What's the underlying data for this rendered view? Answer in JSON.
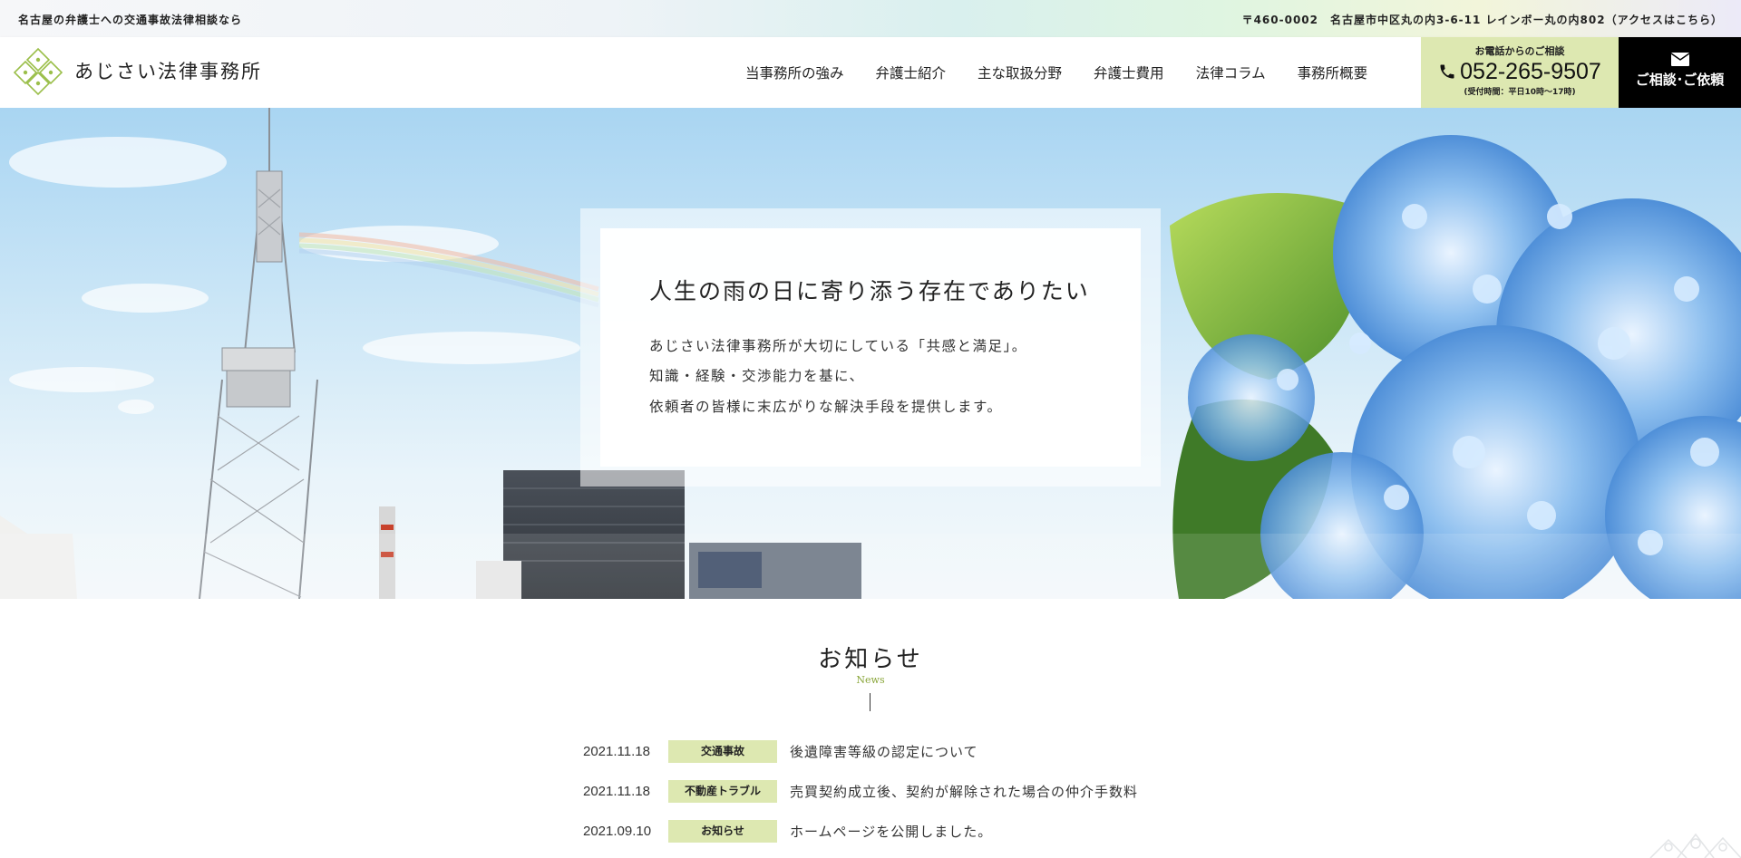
{
  "topbar": {
    "tagline": "名古屋の弁護士への交通事故法律相談なら",
    "address": "〒460-0002　名古屋市中区丸の内3-6-11 レインボー丸の内802（アクセスはこちら）"
  },
  "header": {
    "logo_text": "あじさい法律事務所",
    "nav": [
      "当事務所の強み",
      "弁護士紹介",
      "主な取扱分野",
      "弁護士費用",
      "法律コラム",
      "事務所概要"
    ],
    "tel_label": "お電話からのご相談",
    "tel_number": "052-265-9507",
    "tel_hours": "(受付時間：平日10時〜17時)",
    "consult_label": "ご相談･ご依頼"
  },
  "hero": {
    "title": "人生の雨の日に寄り添う存在でありたい",
    "lines": [
      "あじさい法律事務所が大切にしている「共感と満足」。",
      "知識・経験・交渉能力を基に、",
      "依頼者の皆様に末広がりな解決手段を提供します。"
    ]
  },
  "news": {
    "heading": "お知らせ",
    "subheading": "News",
    "items": [
      {
        "date": "2021.11.18",
        "category": "交通事故",
        "title": "後遺障害等級の認定について"
      },
      {
        "date": "2021.11.18",
        "category": "不動産トラブル",
        "title": "売買契約成立後、契約が解除された場合の仲介手数料"
      },
      {
        "date": "2021.09.10",
        "category": "お知らせ",
        "title": "ホームページを公開しました。"
      }
    ]
  },
  "colors": {
    "accent_green": "#dde8b1",
    "news_sub_green": "#8aa63a",
    "consult_bg": "#000000"
  }
}
